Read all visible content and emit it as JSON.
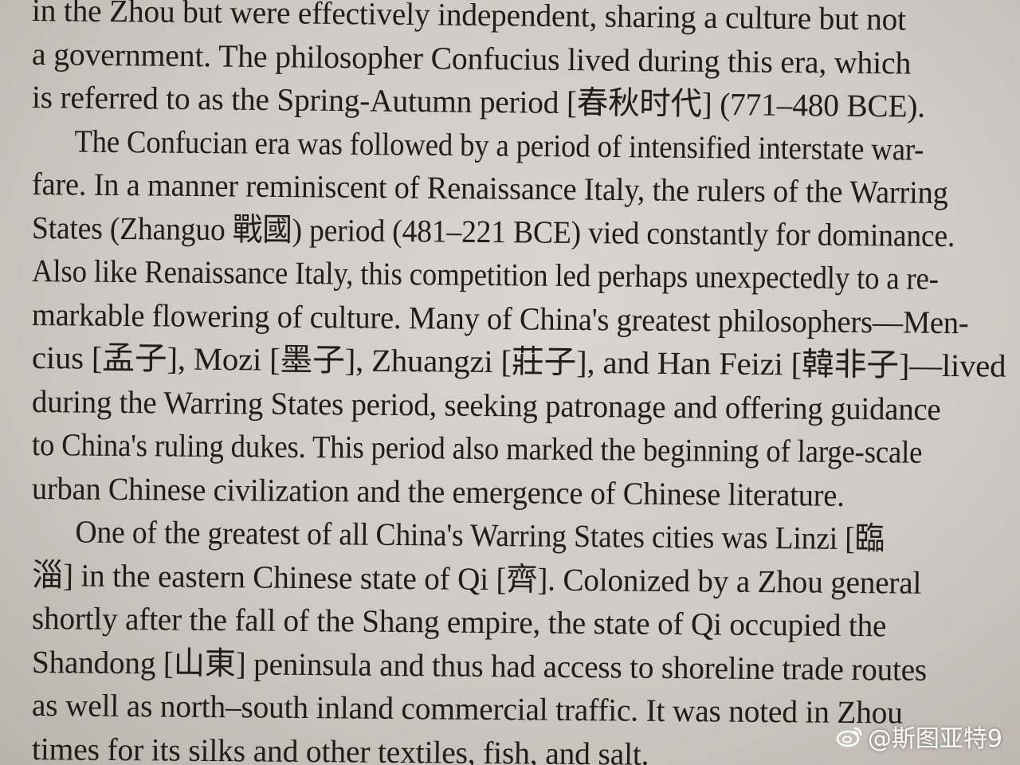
{
  "lines": [
    "in the Zhou but were effectively independent, sharing a culture but not",
    "a government. The philosopher Confucius lived during this era, which",
    "is referred to as the Spring-Autumn period [春秋时代] (771–480 BCE).",
    "The Confucian era was followed by a period of intensified interstate war-",
    "fare. In a manner reminiscent of Renaissance Italy, the rulers of the Warring",
    "States (Zhanguo 戰國) period (481–221 BCE) vied constantly for dominance.",
    "Also like Renaissance Italy, this competition led perhaps unexpectedly to a re-",
    "markable flowering of culture. Many of China's greatest philosophers—Men-",
    "cius [孟子], Mozi [墨子], Zhuangzi [莊子], and Han Feizi [韓非子]—lived",
    "during the Warring States period, seeking patronage and offering guidance",
    "to China's ruling dukes. This period also marked the beginning of large-scale",
    "urban Chinese civilization and the emergence of Chinese literature.",
    "One of the greatest of all China's Warring States cities was Linzi [臨",
    "淄] in the eastern Chinese state of Qi [齊]. Colonized by a Zhou general",
    "shortly after the fall of the Shang empire, the state of Qi occupied the",
    "Shandong [山東] peninsula and thus had access to shoreline trade routes",
    "as well as north–south inland commercial traffic. It was noted in Zhou",
    "times for its silks and other textiles, fish, and salt."
  ],
  "watermark": {
    "text": "@斯图亚特9",
    "icon": "weibo-icon"
  }
}
